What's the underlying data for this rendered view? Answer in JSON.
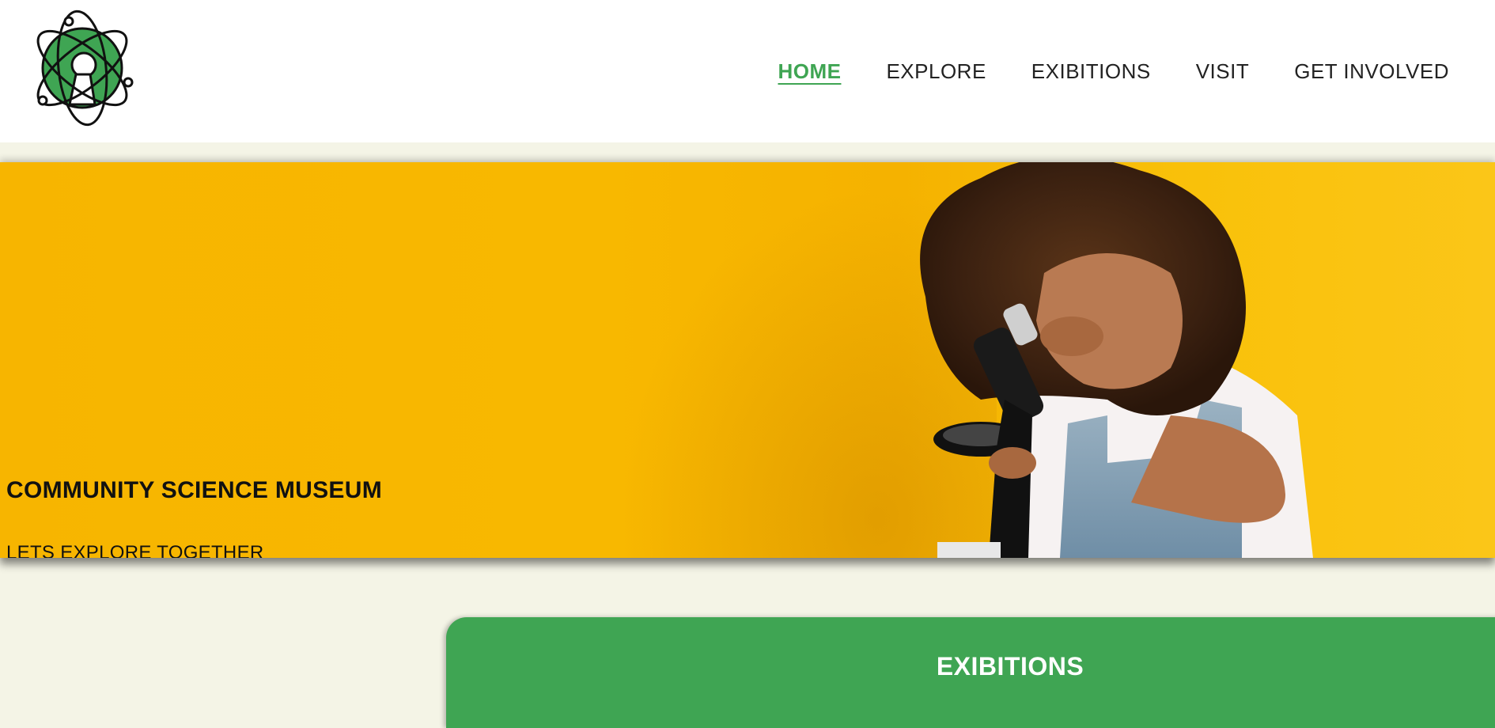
{
  "nav": {
    "items": [
      {
        "label": "HOME",
        "active": true
      },
      {
        "label": "EXPLORE",
        "active": false
      },
      {
        "label": "EXIBITIONS",
        "active": false
      },
      {
        "label": "VISIT",
        "active": false
      },
      {
        "label": "GET INVOLVED",
        "active": false
      }
    ]
  },
  "hero": {
    "title": "COMMUNITY SCIENCE MUSEUM",
    "subtitle": "LETS EXPLORE TOGETHER",
    "image": "girl-looking-through-microscope"
  },
  "section": {
    "title": "EXIBITIONS"
  },
  "colors": {
    "brand_green": "#3fa553",
    "hero_yellow": "#f8b800",
    "page_background": "#f4f4e6",
    "header_background": "#ffffff",
    "text_dark": "#222222"
  },
  "icons": {
    "logo": "atom-keyhole-logo-icon"
  }
}
